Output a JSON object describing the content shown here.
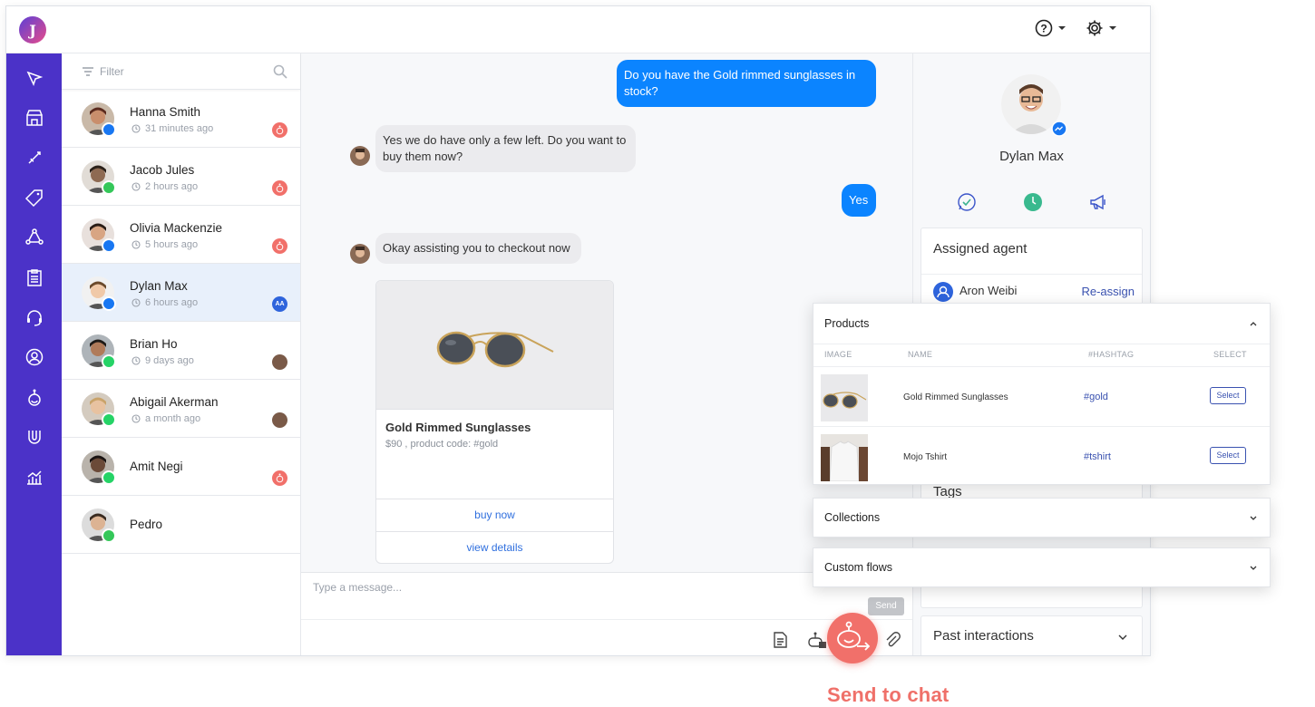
{
  "app": {
    "logo_letter": "J"
  },
  "contacts_panel": {
    "filter_placeholder": "Filter",
    "contacts": [
      {
        "name": "Hanna Smith",
        "time": "31 minutes ago",
        "channel": "messenger",
        "badge": "bot"
      },
      {
        "name": "Jacob Jules",
        "time": "2 hours ago",
        "channel": "imessage",
        "badge": "bot"
      },
      {
        "name": "Olivia Mackenzie",
        "time": "5 hours ago",
        "channel": "messenger",
        "badge": "bot"
      },
      {
        "name": "Dylan Max",
        "time": "6 hours ago",
        "channel": "messenger",
        "badge": "AA",
        "active": true
      },
      {
        "name": "Brian Ho",
        "time": "9 days ago",
        "channel": "whatsapp",
        "badge": "agent"
      },
      {
        "name": "Abigail Akerman",
        "time": "a month ago",
        "channel": "whatsapp",
        "badge": "agent"
      },
      {
        "name": "Amit Negi",
        "time": "",
        "channel": "whatsapp",
        "badge": "bot"
      },
      {
        "name": "Pedro",
        "time": "",
        "channel": "imessage",
        "badge": ""
      }
    ]
  },
  "chat": {
    "messages": [
      {
        "dir": "out",
        "text": "Do you have the Gold rimmed sunglasses in stock?"
      },
      {
        "dir": "in",
        "text": "Yes we do have only a few left. Do you want to buy them now?"
      },
      {
        "dir": "out",
        "text": "Yes"
      },
      {
        "dir": "in",
        "text": "Okay assisting you to checkout now"
      }
    ],
    "product_card": {
      "title": "Gold Rimmed Sunglasses",
      "subtitle": "$90 , product code: #gold",
      "buttons": [
        "buy now",
        "view details"
      ]
    },
    "composer_placeholder": "Type a message...",
    "send_label": "Send"
  },
  "profile": {
    "name": "Dylan Max",
    "assigned_agent_title": "Assigned agent",
    "agent_name": "Aron Weibi",
    "reassign_label": "Re-assign",
    "tags_title": "Tags",
    "past_interactions_title": "Past interactions"
  },
  "products_popup": {
    "title": "Products",
    "columns": [
      "IMAGE",
      "NAME",
      "#HASHTAG",
      "SELECT"
    ],
    "rows": [
      {
        "name": "Gold Rimmed Sunglasses",
        "hashtag": "#gold",
        "select": "Select"
      },
      {
        "name": "Mojo Tshirt",
        "hashtag": "#tshirt",
        "select": "Select"
      }
    ],
    "collections_title": "Collections",
    "custom_flows_title": "Custom flows"
  },
  "send_to_chat_label": "Send to chat",
  "colors": {
    "nav": "#4b32c8",
    "bubble_out": "#0b84ff",
    "accent_red": "#f1706a",
    "link": "#2f6fde"
  }
}
